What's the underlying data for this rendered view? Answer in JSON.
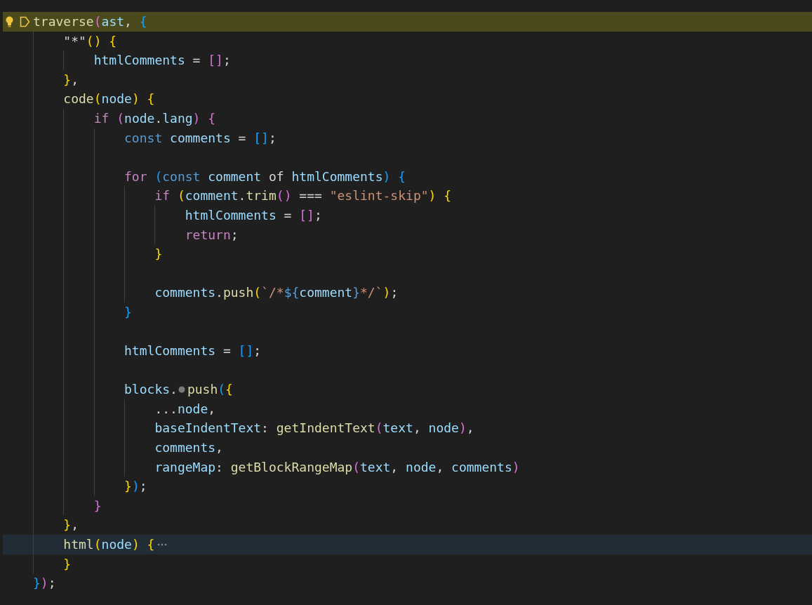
{
  "editor": {
    "lines": [
      {
        "kind": "execution",
        "lightbulb": true,
        "folded": false,
        "tokens": [
          {
            "kind": "fn",
            "text": "traverse"
          },
          {
            "kind": "bp",
            "text": "("
          },
          {
            "kind": "var",
            "text": "ast"
          },
          {
            "kind": "p",
            "text": ", "
          },
          {
            "kind": "bb",
            "text": "{"
          }
        ]
      },
      {
        "kind": "plain",
        "lightbulb": false,
        "folded": false,
        "tokens": [
          {
            "kind": "p",
            "text": "    \"*\""
          },
          {
            "kind": "bg",
            "text": "() {"
          }
        ]
      },
      {
        "kind": "plain",
        "lightbulb": false,
        "folded": false,
        "tokens": [
          {
            "kind": "var",
            "text": "        htmlComments"
          },
          {
            "kind": "p",
            "text": " = "
          },
          {
            "kind": "bp",
            "text": "[]"
          },
          {
            "kind": "p",
            "text": ";"
          }
        ]
      },
      {
        "kind": "plain",
        "lightbulb": false,
        "folded": false,
        "tokens": [
          {
            "kind": "bg",
            "text": "    }"
          },
          {
            "kind": "p",
            "text": ","
          }
        ]
      },
      {
        "kind": "plain",
        "lightbulb": false,
        "folded": false,
        "tokens": [
          {
            "kind": "fn",
            "text": "    code"
          },
          {
            "kind": "bg",
            "text": "("
          },
          {
            "kind": "var",
            "text": "node"
          },
          {
            "kind": "bg",
            "text": ") {"
          }
        ]
      },
      {
        "kind": "plain",
        "lightbulb": false,
        "folded": false,
        "tokens": [
          {
            "kind": "kw",
            "text": "        if "
          },
          {
            "kind": "bp",
            "text": "("
          },
          {
            "kind": "var",
            "text": "node"
          },
          {
            "kind": "p",
            "text": "."
          },
          {
            "kind": "var",
            "text": "lang"
          },
          {
            "kind": "bp",
            "text": ") {"
          }
        ]
      },
      {
        "kind": "plain",
        "lightbulb": false,
        "folded": false,
        "tokens": [
          {
            "kind": "st",
            "text": "            const "
          },
          {
            "kind": "var",
            "text": "comments"
          },
          {
            "kind": "p",
            "text": " = "
          },
          {
            "kind": "bb",
            "text": "[]"
          },
          {
            "kind": "p",
            "text": ";"
          }
        ]
      },
      {
        "kind": "plain",
        "lightbulb": false,
        "folded": false
      },
      {
        "kind": "plain",
        "lightbulb": false,
        "folded": false,
        "tokens": [
          {
            "kind": "kw",
            "text": "            for "
          },
          {
            "kind": "bb",
            "text": "("
          },
          {
            "kind": "st",
            "text": "const "
          },
          {
            "kind": "var",
            "text": "comment"
          },
          {
            "kind": "p",
            "text": " of "
          },
          {
            "kind": "var",
            "text": "htmlComments"
          },
          {
            "kind": "bb",
            "text": ") {"
          }
        ]
      },
      {
        "kind": "plain",
        "lightbulb": false,
        "folded": false,
        "tokens": [
          {
            "kind": "kw",
            "text": "                if "
          },
          {
            "kind": "bg",
            "text": "("
          },
          {
            "kind": "var",
            "text": "comment"
          },
          {
            "kind": "p",
            "text": "."
          },
          {
            "kind": "fn",
            "text": "trim"
          },
          {
            "kind": "bp",
            "text": "()"
          },
          {
            "kind": "p",
            "text": " === "
          },
          {
            "kind": "str",
            "text": "\"eslint-skip\""
          },
          {
            "kind": "bg",
            "text": ") {"
          }
        ]
      },
      {
        "kind": "plain",
        "lightbulb": false,
        "folded": false,
        "tokens": [
          {
            "kind": "var",
            "text": "                    htmlComments"
          },
          {
            "kind": "p",
            "text": " = "
          },
          {
            "kind": "bp",
            "text": "[]"
          },
          {
            "kind": "p",
            "text": ";"
          }
        ]
      },
      {
        "kind": "plain",
        "lightbulb": false,
        "folded": false,
        "tokens": [
          {
            "kind": "kw",
            "text": "                    return"
          },
          {
            "kind": "p",
            "text": ";"
          }
        ]
      },
      {
        "kind": "plain",
        "lightbulb": false,
        "folded": false,
        "tokens": [
          {
            "kind": "bg",
            "text": "                }"
          }
        ]
      },
      {
        "kind": "plain",
        "lightbulb": false,
        "folded": false
      },
      {
        "kind": "plain",
        "lightbulb": false,
        "folded": false,
        "tokens": [
          {
            "kind": "var",
            "text": "                comments"
          },
          {
            "kind": "p",
            "text": "."
          },
          {
            "kind": "fn",
            "text": "push"
          },
          {
            "kind": "bg",
            "text": "("
          },
          {
            "kind": "str",
            "text": "`/*"
          },
          {
            "kind": "st",
            "text": "${"
          },
          {
            "kind": "var",
            "text": "comment"
          },
          {
            "kind": "st",
            "text": "}"
          },
          {
            "kind": "str",
            "text": "*/`"
          },
          {
            "kind": "bg",
            "text": ")"
          },
          {
            "kind": "p",
            "text": ";"
          }
        ]
      },
      {
        "kind": "plain",
        "lightbulb": false,
        "folded": false,
        "tokens": [
          {
            "kind": "bb",
            "text": "            }"
          }
        ]
      },
      {
        "kind": "plain",
        "lightbulb": false,
        "folded": false
      },
      {
        "kind": "plain",
        "lightbulb": false,
        "folded": false,
        "tokens": [
          {
            "kind": "var",
            "text": "            htmlComments"
          },
          {
            "kind": "p",
            "text": " = "
          },
          {
            "kind": "bb",
            "text": "[]"
          },
          {
            "kind": "p",
            "text": ";"
          }
        ]
      },
      {
        "kind": "plain",
        "lightbulb": false,
        "folded": false
      },
      {
        "kind": "plain",
        "lightbulb": false,
        "folded": false,
        "tokens": [
          {
            "kind": "var",
            "text": "            blocks"
          },
          {
            "kind": "p",
            "text": "."
          },
          {
            "kind": "dot"
          },
          {
            "kind": "fn",
            "text": "push"
          },
          {
            "kind": "bb",
            "text": "("
          },
          {
            "kind": "bg",
            "text": "{"
          }
        ]
      },
      {
        "kind": "plain",
        "lightbulb": false,
        "folded": false,
        "tokens": [
          {
            "kind": "p",
            "text": "                ..."
          },
          {
            "kind": "var",
            "text": "node"
          },
          {
            "kind": "p",
            "text": ","
          }
        ]
      },
      {
        "kind": "plain",
        "lightbulb": false,
        "folded": false,
        "tokens": [
          {
            "kind": "var",
            "text": "                baseIndentText"
          },
          {
            "kind": "p",
            "text": ": "
          },
          {
            "kind": "fn",
            "text": "getIndentText"
          },
          {
            "kind": "bp",
            "text": "("
          },
          {
            "kind": "var",
            "text": "text"
          },
          {
            "kind": "p",
            "text": ", "
          },
          {
            "kind": "var",
            "text": "node"
          },
          {
            "kind": "bp",
            "text": ")"
          },
          {
            "kind": "p",
            "text": ","
          }
        ]
      },
      {
        "kind": "plain",
        "lightbulb": false,
        "folded": false,
        "tokens": [
          {
            "kind": "var",
            "text": "                comments"
          },
          {
            "kind": "p",
            "text": ","
          }
        ]
      },
      {
        "kind": "plain",
        "lightbulb": false,
        "folded": false,
        "tokens": [
          {
            "kind": "var",
            "text": "                rangeMap"
          },
          {
            "kind": "p",
            "text": ": "
          },
          {
            "kind": "fn",
            "text": "getBlockRangeMap"
          },
          {
            "kind": "bp",
            "text": "("
          },
          {
            "kind": "var",
            "text": "text"
          },
          {
            "kind": "p",
            "text": ", "
          },
          {
            "kind": "var",
            "text": "node"
          },
          {
            "kind": "p",
            "text": ", "
          },
          {
            "kind": "var",
            "text": "comments"
          },
          {
            "kind": "bp",
            "text": ")"
          }
        ]
      },
      {
        "kind": "plain",
        "lightbulb": false,
        "folded": false,
        "tokens": [
          {
            "kind": "bg",
            "text": "            }"
          },
          {
            "kind": "bb",
            "text": ")"
          },
          {
            "kind": "p",
            "text": ";"
          }
        ]
      },
      {
        "kind": "plain",
        "lightbulb": false,
        "folded": false,
        "tokens": [
          {
            "kind": "bp",
            "text": "        }"
          }
        ]
      },
      {
        "kind": "plain",
        "lightbulb": false,
        "folded": false,
        "tokens": [
          {
            "kind": "bg",
            "text": "    }"
          },
          {
            "kind": "p",
            "text": ","
          }
        ]
      },
      {
        "kind": "cursor",
        "lightbulb": false,
        "folded": true,
        "tokens": [
          {
            "kind": "fn",
            "text": "    html"
          },
          {
            "kind": "bg",
            "text": "("
          },
          {
            "kind": "var",
            "text": "node"
          },
          {
            "kind": "bg",
            "text": ") {"
          }
        ]
      },
      {
        "kind": "plain",
        "lightbulb": false,
        "folded": false,
        "tokens": [
          {
            "kind": "bg",
            "text": "    }"
          }
        ]
      },
      {
        "kind": "plain",
        "lightbulb": false,
        "folded": false,
        "tokens": [
          {
            "kind": "bb",
            "text": "}"
          },
          {
            "kind": "bp",
            "text": ")"
          },
          {
            "kind": "p",
            "text": ";"
          }
        ]
      }
    ]
  }
}
